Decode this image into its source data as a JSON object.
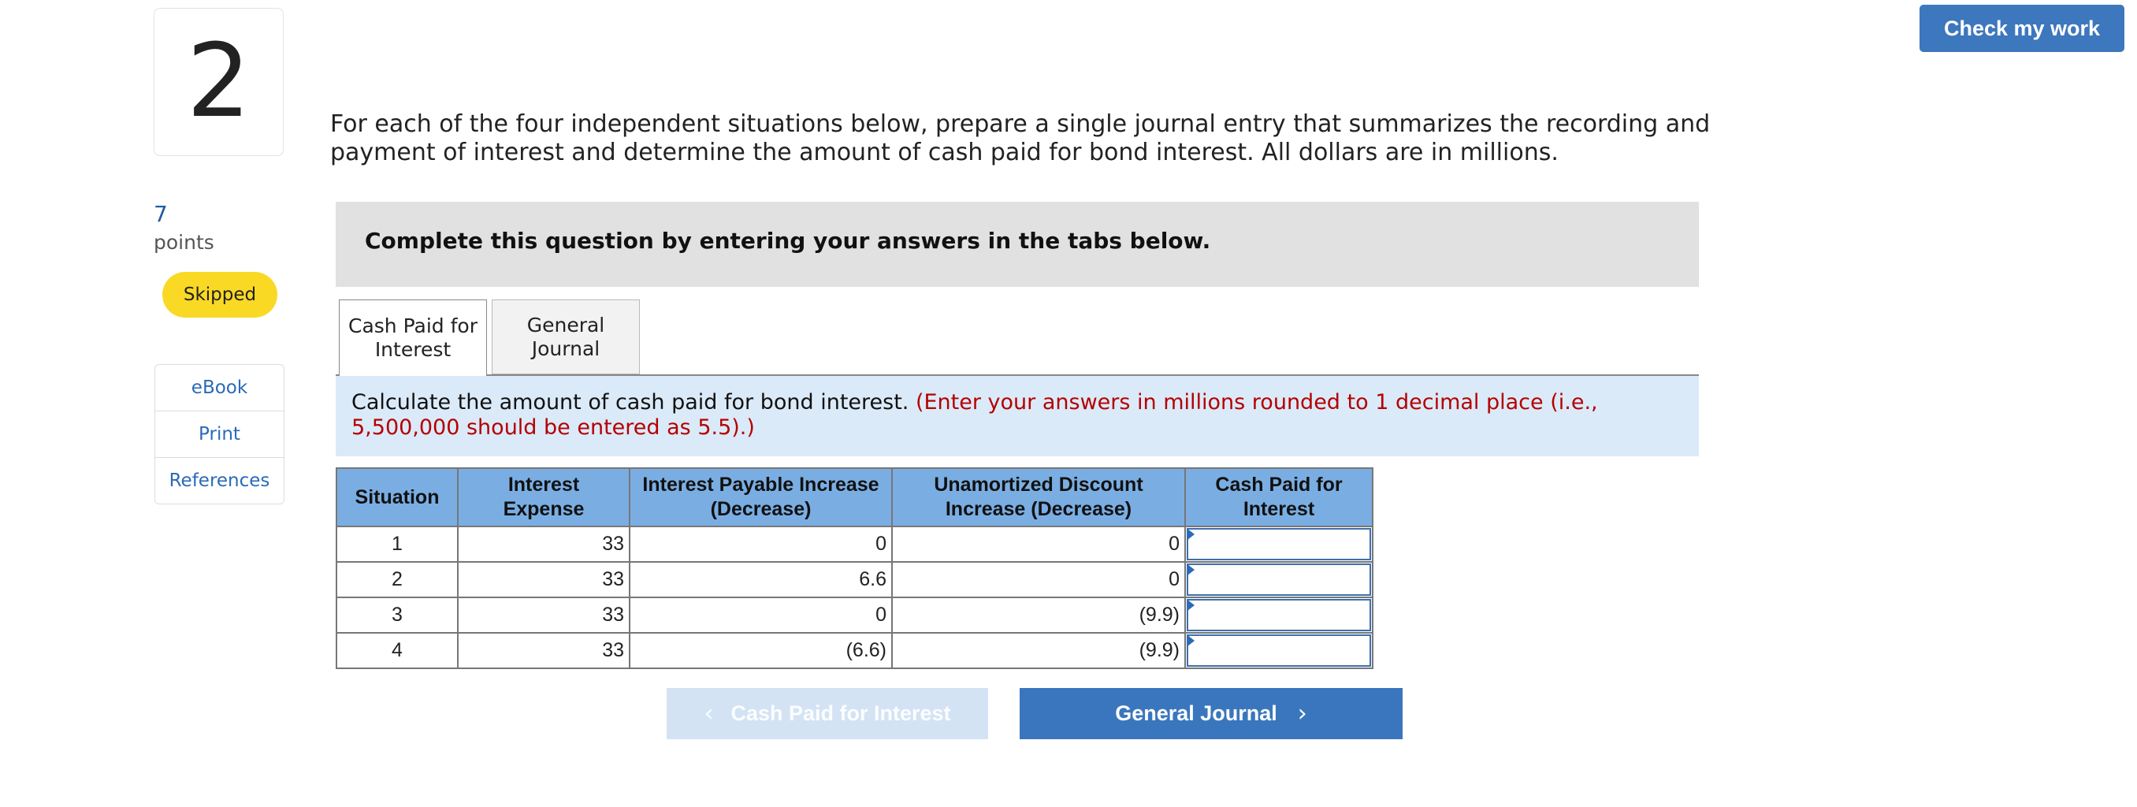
{
  "question": {
    "number": "2",
    "points_value": "7",
    "points_label": "points",
    "status": "Skipped"
  },
  "resources": [
    "eBook",
    "Print",
    "References"
  ],
  "header": {
    "check_button": "Check my work"
  },
  "instructions": "For each of the four independent situations below, prepare a single journal entry that summarizes the recording and payment of interest and determine the amount of cash paid for bond interest. All dollars are in millions.",
  "banner": "Complete this question by entering your answers in the tabs below.",
  "tabs": [
    {
      "label_line1": "Cash Paid for",
      "label_line2": "Interest",
      "active": true
    },
    {
      "label_line1": "General",
      "label_line2": "Journal",
      "active": false
    }
  ],
  "panel": {
    "text": "Calculate the amount of cash paid for bond interest.",
    "hint": "(Enter your answers in millions rounded to 1 decimal place (i.e., 5,500,000 should be entered as 5.5).)"
  },
  "table": {
    "headers": [
      {
        "line1": "Situation",
        "line2": ""
      },
      {
        "line1": "Interest",
        "line2": "Expense"
      },
      {
        "line1": "Interest Payable Increase",
        "line2": "(Decrease)"
      },
      {
        "line1": "Unamortized Discount",
        "line2": "Increase (Decrease)"
      },
      {
        "line1": "Cash Paid for",
        "line2": "Interest"
      }
    ],
    "rows": [
      {
        "situation": "1",
        "interest_expense": "33",
        "payable_change": "0",
        "discount_change": "0",
        "cash_paid": ""
      },
      {
        "situation": "2",
        "interest_expense": "33",
        "payable_change": "6.6",
        "discount_change": "0",
        "cash_paid": ""
      },
      {
        "situation": "3",
        "interest_expense": "33",
        "payable_change": "0",
        "discount_change": "(9.9)",
        "cash_paid": ""
      },
      {
        "situation": "4",
        "interest_expense": "33",
        "payable_change": "(6.6)",
        "discount_change": "(9.9)",
        "cash_paid": ""
      }
    ]
  },
  "nav": {
    "prev_label": "Cash Paid for Interest",
    "next_label": "General Journal",
    "prev_enabled": false
  },
  "colors": {
    "accent": "#3a76bd",
    "table_header": "#7aaee3",
    "hint_red": "#b40000",
    "skipped_badge": "#f9d923",
    "panel_bg": "#dbeaf8"
  },
  "icons": {
    "prev": "chevron-left-icon",
    "next": "chevron-right-icon",
    "input_flag": "input-flag-icon"
  }
}
